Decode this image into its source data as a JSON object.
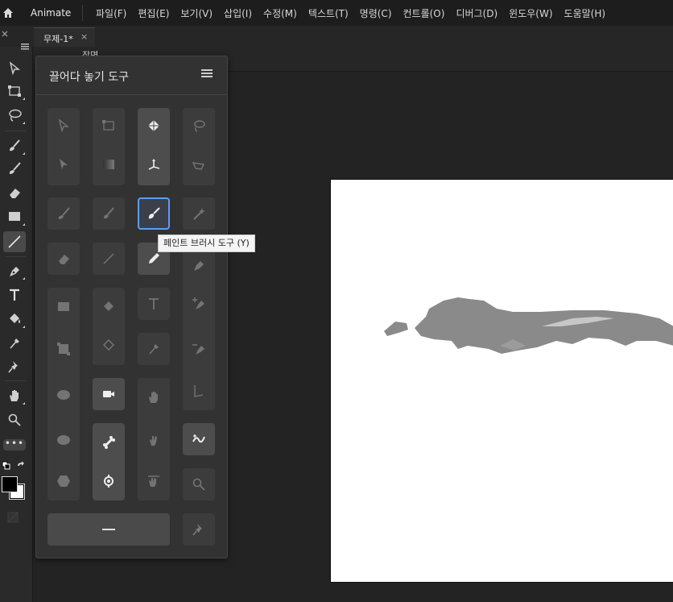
{
  "app": {
    "name": "Animate"
  },
  "menu": {
    "items": [
      "파일(F)",
      "편집(E)",
      "보기(V)",
      "삽입(I)",
      "수정(M)",
      "텍스트(T)",
      "명령(C)",
      "컨트롤(O)",
      "디버그(D)",
      "윈도우(W)",
      "도움말(H)"
    ]
  },
  "document": {
    "tab_label": "무제-1*",
    "close_glyph": "×",
    "scene_label": "장면"
  },
  "panel": {
    "title": "끌어다 놓기 도구",
    "tooltip": "페인트 브러시 도구 (Y)",
    "wide_button": "separator"
  },
  "toolbar": {
    "more_label": "•••",
    "tools": [
      "select-icon",
      "free-transform-icon",
      "lasso-icon",
      "fluid-brush-icon",
      "classic-brush-icon",
      "eraser-icon",
      "rectangle-icon",
      "line-icon",
      "pen-icon",
      "text-icon",
      "paint-bucket-icon",
      "eyedropper-icon",
      "pin-icon",
      "hand-icon",
      "zoom-icon"
    ]
  },
  "colors": {
    "accent": "#5b9ef5",
    "stroke": "#000000",
    "fill": "#ffffff",
    "artwork": "#8a8a8a"
  }
}
